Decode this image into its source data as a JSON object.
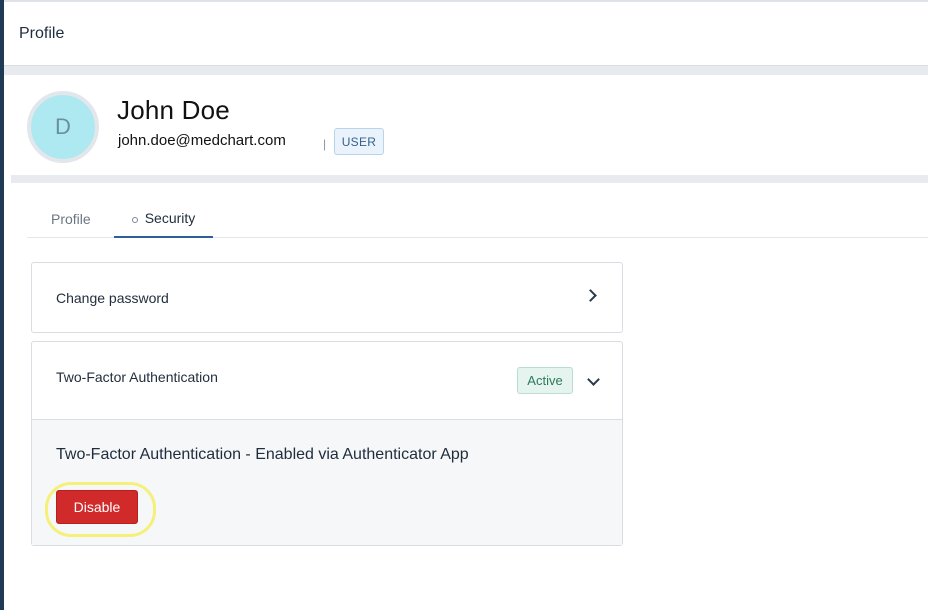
{
  "header": {
    "title": "Profile"
  },
  "user": {
    "avatar_initial": "D",
    "name": "John Doe",
    "email": "john.doe@medchart.com",
    "separator": "|",
    "role": "USER"
  },
  "tabs": [
    {
      "label": "Profile",
      "active": false
    },
    {
      "label": "Security",
      "active": true
    }
  ],
  "security": {
    "change_password": {
      "label": "Change password"
    },
    "two_factor": {
      "label": "Two-Factor Authentication",
      "status": "Active",
      "detail_title": "Two-Factor Authentication - Enabled via Authenticator App",
      "disable_label": "Disable"
    }
  },
  "colors": {
    "accent": "#2f5f98",
    "danger": "#d02a2a",
    "success_text": "#2c7a5c",
    "avatar_bg": "#aee9f2",
    "highlight": "#f4f07a"
  },
  "icons": {
    "change_password": "chevron-right-icon",
    "two_factor": "chevron-down-icon",
    "security_tab": "circle-icon"
  }
}
